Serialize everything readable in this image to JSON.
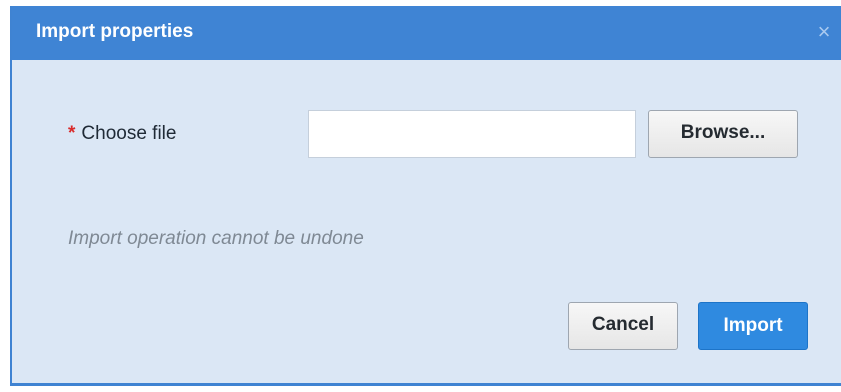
{
  "dialog": {
    "title": "Import properties",
    "close_icon": "close-icon",
    "close_glyph": "×",
    "colors": {
      "titlebar": "#3f84d4",
      "body": "#dbe7f5",
      "primary_button": "#2f8ae0",
      "required_marker": "#d92b2b"
    }
  },
  "form": {
    "required_marker": "*",
    "file_label": "Choose file",
    "file_value": "",
    "browse_label": "Browse...",
    "note": "Import operation cannot be undone"
  },
  "actions": {
    "cancel_label": "Cancel",
    "import_label": "Import"
  }
}
